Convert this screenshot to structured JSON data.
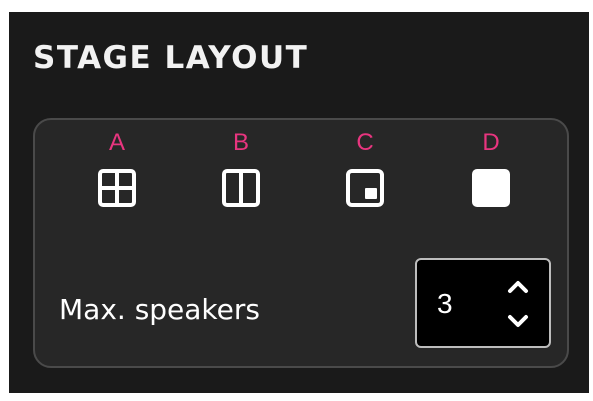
{
  "title": "STAGE LAYOUT",
  "layouts": [
    {
      "letter": "A",
      "icon": "grid-four-icon"
    },
    {
      "letter": "B",
      "icon": "split-two-columns-icon"
    },
    {
      "letter": "C",
      "icon": "picture-in-picture-icon"
    },
    {
      "letter": "D",
      "icon": "single-full-square-icon"
    }
  ],
  "max_speakers": {
    "label": "Max. speakers",
    "value": "3"
  },
  "colors": {
    "background": "#1a1a1a",
    "card": "#272727",
    "accent_letter": "#e8357f",
    "text": "#ffffff"
  }
}
